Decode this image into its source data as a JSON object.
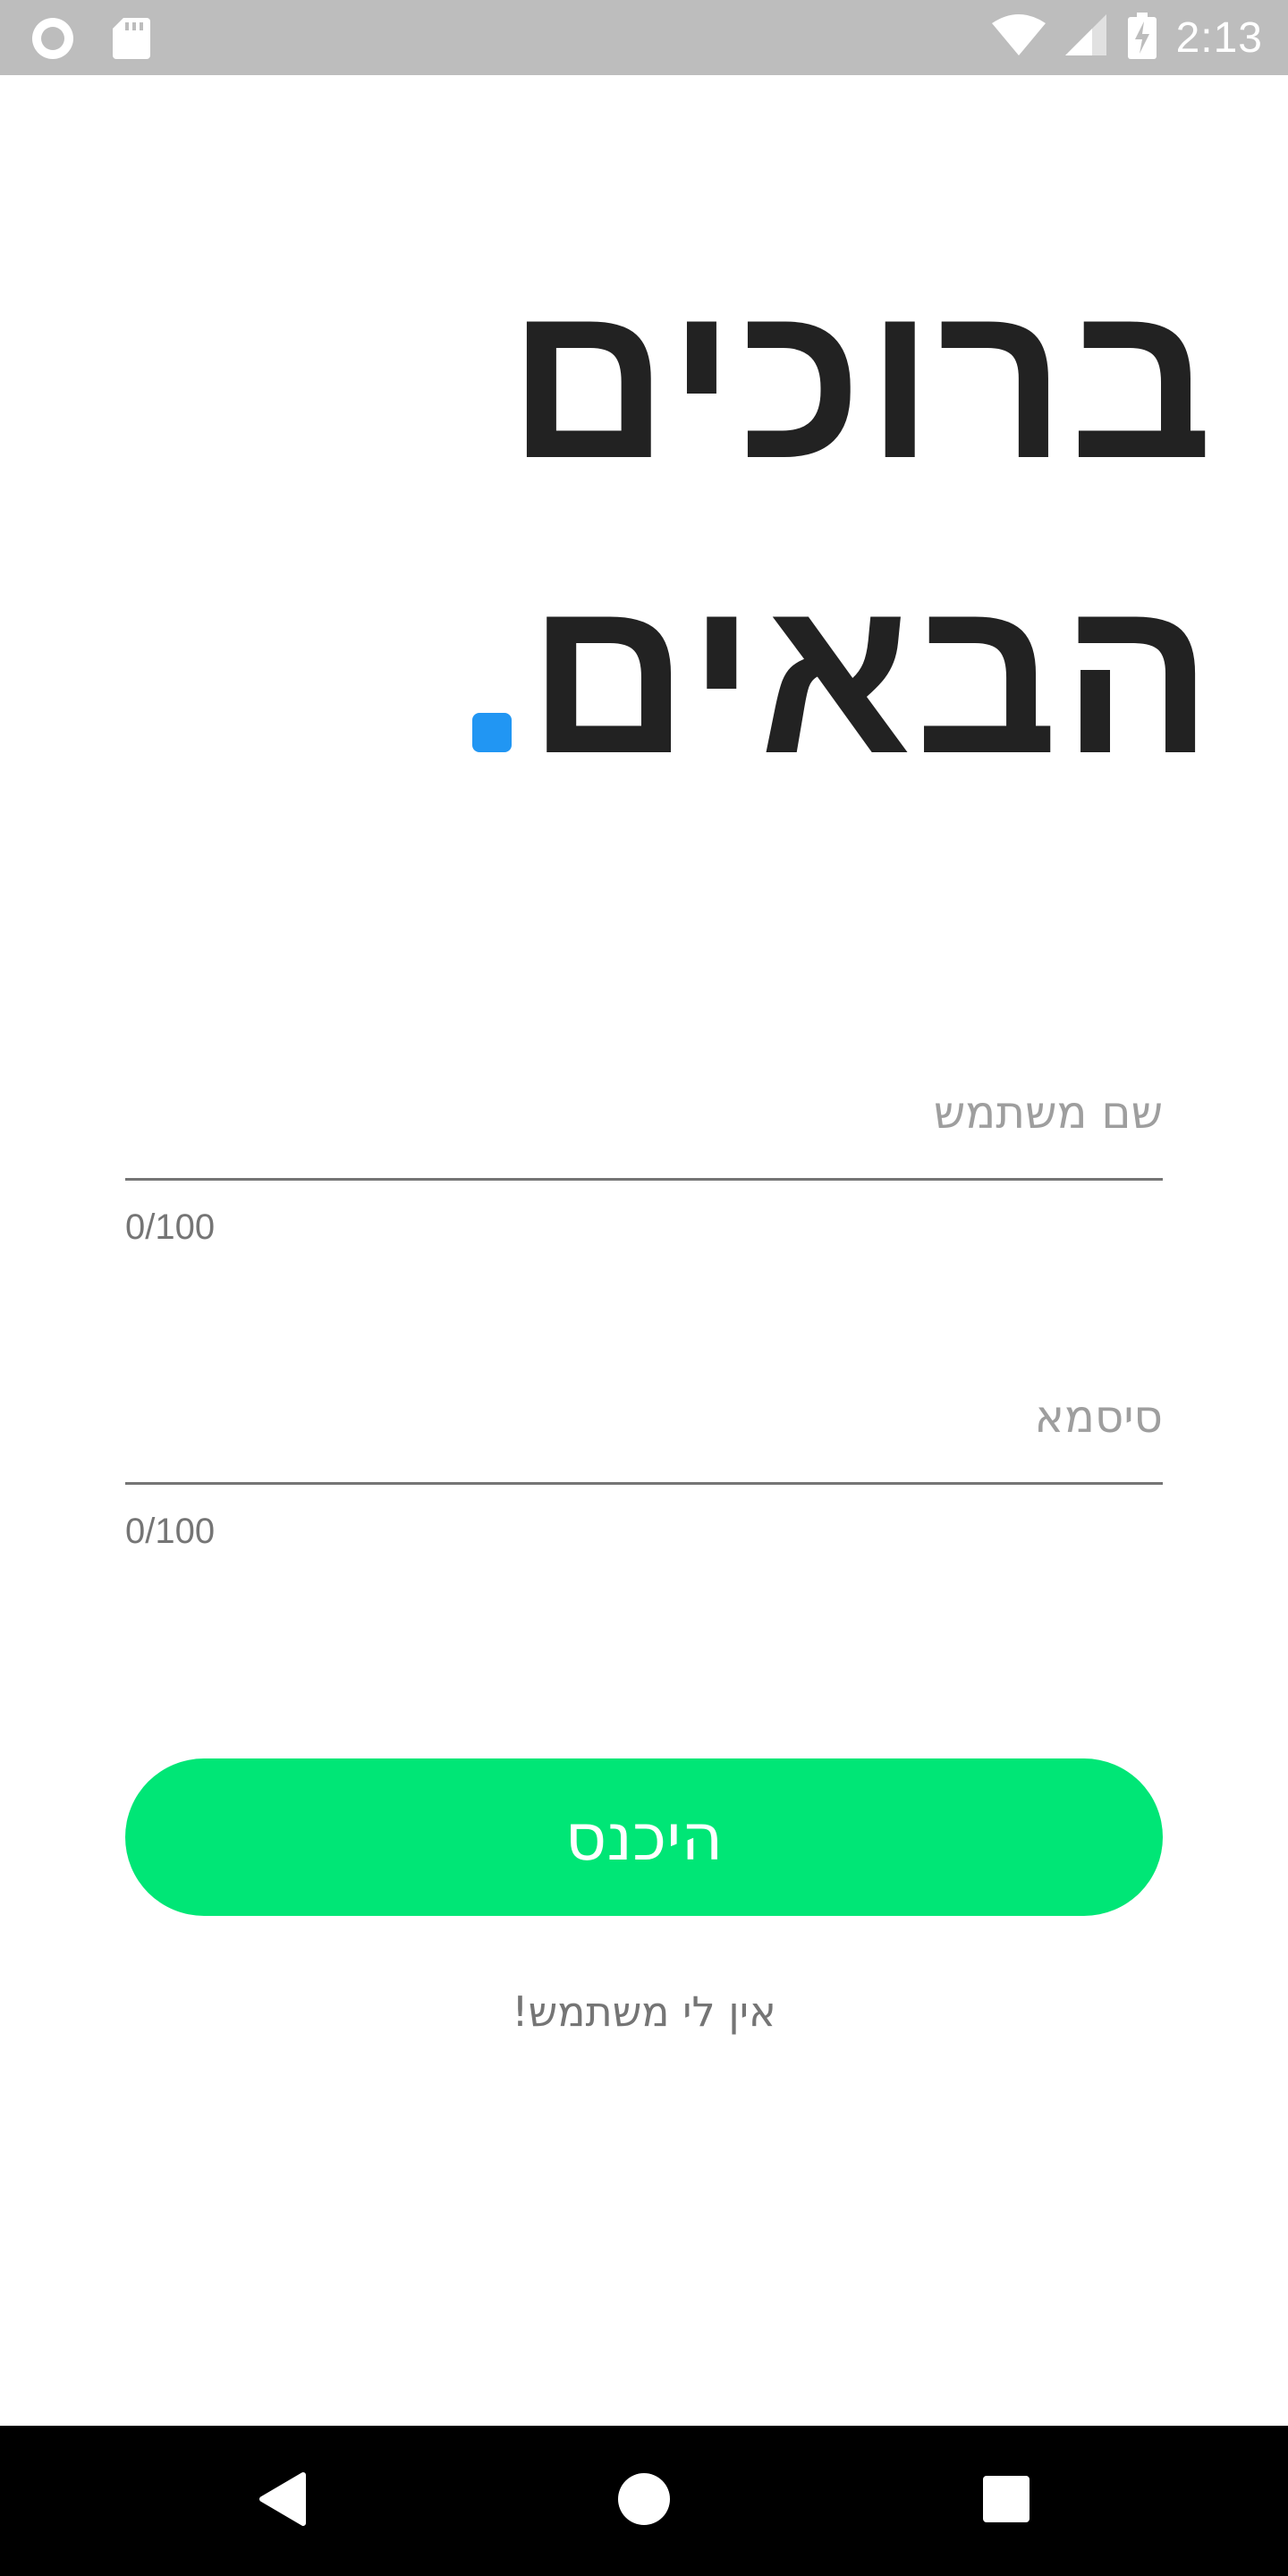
{
  "status_bar": {
    "time": "2:13",
    "left_icons": [
      "record-icon",
      "sd-card-icon"
    ],
    "right_icons": [
      "wifi-icon",
      "cellular-signal-icon",
      "battery-charging-icon"
    ],
    "background": "#bdbdbd"
  },
  "title": {
    "line1": "ברוכים",
    "line2": "הבאים",
    "dot_color": "#2196f3"
  },
  "form": {
    "username": {
      "placeholder": "שם משתמש",
      "value": "",
      "counter": "0/100"
    },
    "password": {
      "placeholder": "סיסמא",
      "value": "",
      "counter": "0/100"
    },
    "login_label": "היכנס",
    "login_color": "#00e676",
    "register_label": "אין לי משתמש!"
  },
  "nav_bar": {
    "buttons": [
      "back-icon",
      "home-icon",
      "recents-icon"
    ]
  }
}
